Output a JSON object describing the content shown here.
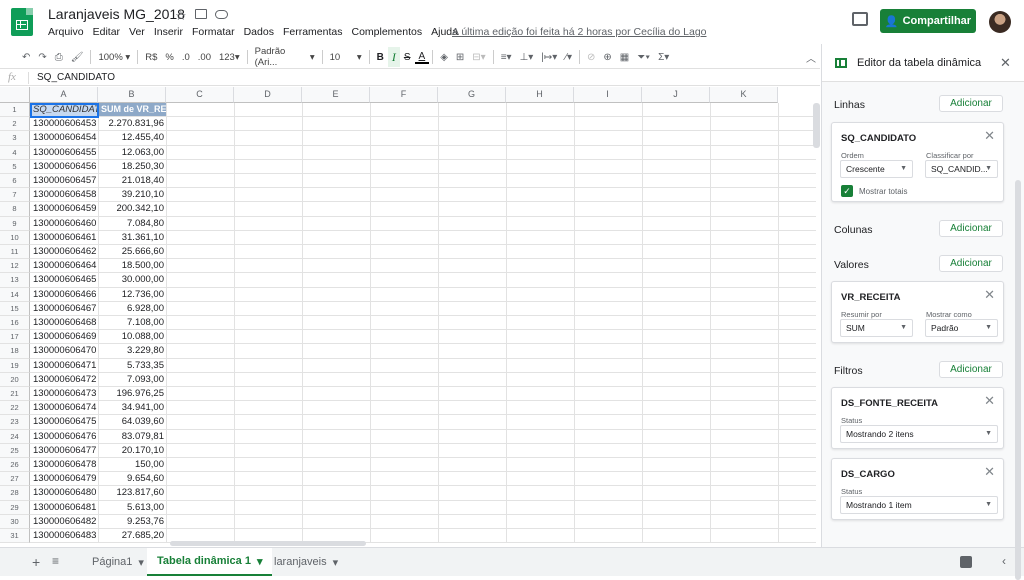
{
  "header": {
    "doc_title": "Laranjaveis MG_2018",
    "menus": [
      "Arquivo",
      "Editar",
      "Ver",
      "Inserir",
      "Formatar",
      "Dados",
      "Ferramentas",
      "Complementos",
      "Ajuda"
    ],
    "last_edit": "A última edição foi feita há 2 horas por Cecília do Lago",
    "share_label": "Compartilhar",
    "accent": "#188038"
  },
  "toolbar": {
    "zoom": "100%",
    "currency": "R$",
    "percent": "%",
    "dec_less": ".0",
    "dec_more": ".00",
    "num_format": "123",
    "font": "Padrão (Ari...",
    "font_size": "10",
    "bold": "B",
    "italic": "I",
    "strike": "S",
    "text_color": "A"
  },
  "formula": {
    "fx": "fx",
    "value": "SQ_CANDIDATO"
  },
  "grid": {
    "columns": [
      "A",
      "B",
      "C",
      "D",
      "E",
      "F",
      "G",
      "H",
      "I",
      "J",
      "K"
    ],
    "header_a": "SQ_CANDIDATO",
    "header_b": "SUM de VR_RECEITA",
    "rows": [
      {
        "n": "1"
      },
      {
        "n": "2",
        "a": "130000606453",
        "b": "2.270.831,96"
      },
      {
        "n": "3",
        "a": "130000606454",
        "b": "12.455,40"
      },
      {
        "n": "4",
        "a": "130000606455",
        "b": "12.063,00"
      },
      {
        "n": "5",
        "a": "130000606456",
        "b": "18.250,30"
      },
      {
        "n": "6",
        "a": "130000606457",
        "b": "21.018,40"
      },
      {
        "n": "7",
        "a": "130000606458",
        "b": "39.210,10"
      },
      {
        "n": "8",
        "a": "130000606459",
        "b": "200.342,10"
      },
      {
        "n": "9",
        "a": "130000606460",
        "b": "7.084,80"
      },
      {
        "n": "10",
        "a": "130000606461",
        "b": "31.361,10"
      },
      {
        "n": "11",
        "a": "130000606462",
        "b": "25.666,60"
      },
      {
        "n": "12",
        "a": "130000606464",
        "b": "18.500,00"
      },
      {
        "n": "13",
        "a": "130000606465",
        "b": "30.000,00"
      },
      {
        "n": "14",
        "a": "130000606466",
        "b": "12.736,00"
      },
      {
        "n": "15",
        "a": "130000606467",
        "b": "6.928,00"
      },
      {
        "n": "16",
        "a": "130000606468",
        "b": "7.108,00"
      },
      {
        "n": "17",
        "a": "130000606469",
        "b": "10.088,00"
      },
      {
        "n": "18",
        "a": "130000606470",
        "b": "3.229,80"
      },
      {
        "n": "19",
        "a": "130000606471",
        "b": "5.733,35"
      },
      {
        "n": "20",
        "a": "130000606472",
        "b": "7.093,00"
      },
      {
        "n": "21",
        "a": "130000606473",
        "b": "196.976,25"
      },
      {
        "n": "22",
        "a": "130000606474",
        "b": "34.941,00"
      },
      {
        "n": "23",
        "a": "130000606475",
        "b": "64.039,60"
      },
      {
        "n": "24",
        "a": "130000606476",
        "b": "83.079,81"
      },
      {
        "n": "25",
        "a": "130000606477",
        "b": "20.170,10"
      },
      {
        "n": "26",
        "a": "130000606478",
        "b": "150,00"
      },
      {
        "n": "27",
        "a": "130000606479",
        "b": "9.654,60"
      },
      {
        "n": "28",
        "a": "130000606480",
        "b": "123.817,60"
      },
      {
        "n": "29",
        "a": "130000606481",
        "b": "5.613,00"
      },
      {
        "n": "30",
        "a": "130000606482",
        "b": "9.253,76"
      },
      {
        "n": "31",
        "a": "130000606483",
        "b": "27.685,20"
      }
    ]
  },
  "sheets": {
    "tabs": [
      "Página1",
      "Tabela dinâmica 1",
      "laranjaveis"
    ],
    "active": 1
  },
  "panel": {
    "title": "Editor da tabela dinâmica",
    "add_label": "Adicionar",
    "rows_label": "Linhas",
    "columns_label": "Colunas",
    "values_label": "Valores",
    "filters_label": "Filtros",
    "row_field": {
      "name": "SQ_CANDIDATO",
      "order_label": "Ordem",
      "order_value": "Crescente",
      "sort_by_label": "Classificar por",
      "sort_by_value": "SQ_CANDID...",
      "show_totals": "Mostrar totais"
    },
    "value_field": {
      "name": "VR_RECEITA",
      "summarize_label": "Resumir por",
      "summarize_value": "SUM",
      "show_as_label": "Mostrar como",
      "show_as_value": "Padrão"
    },
    "filters": [
      {
        "name": "DS_FONTE_RECEITA",
        "status_label": "Status",
        "status_value": "Mostrando 2 itens"
      },
      {
        "name": "DS_CARGO",
        "status_label": "Status",
        "status_value": "Mostrando 1 item"
      }
    ]
  }
}
